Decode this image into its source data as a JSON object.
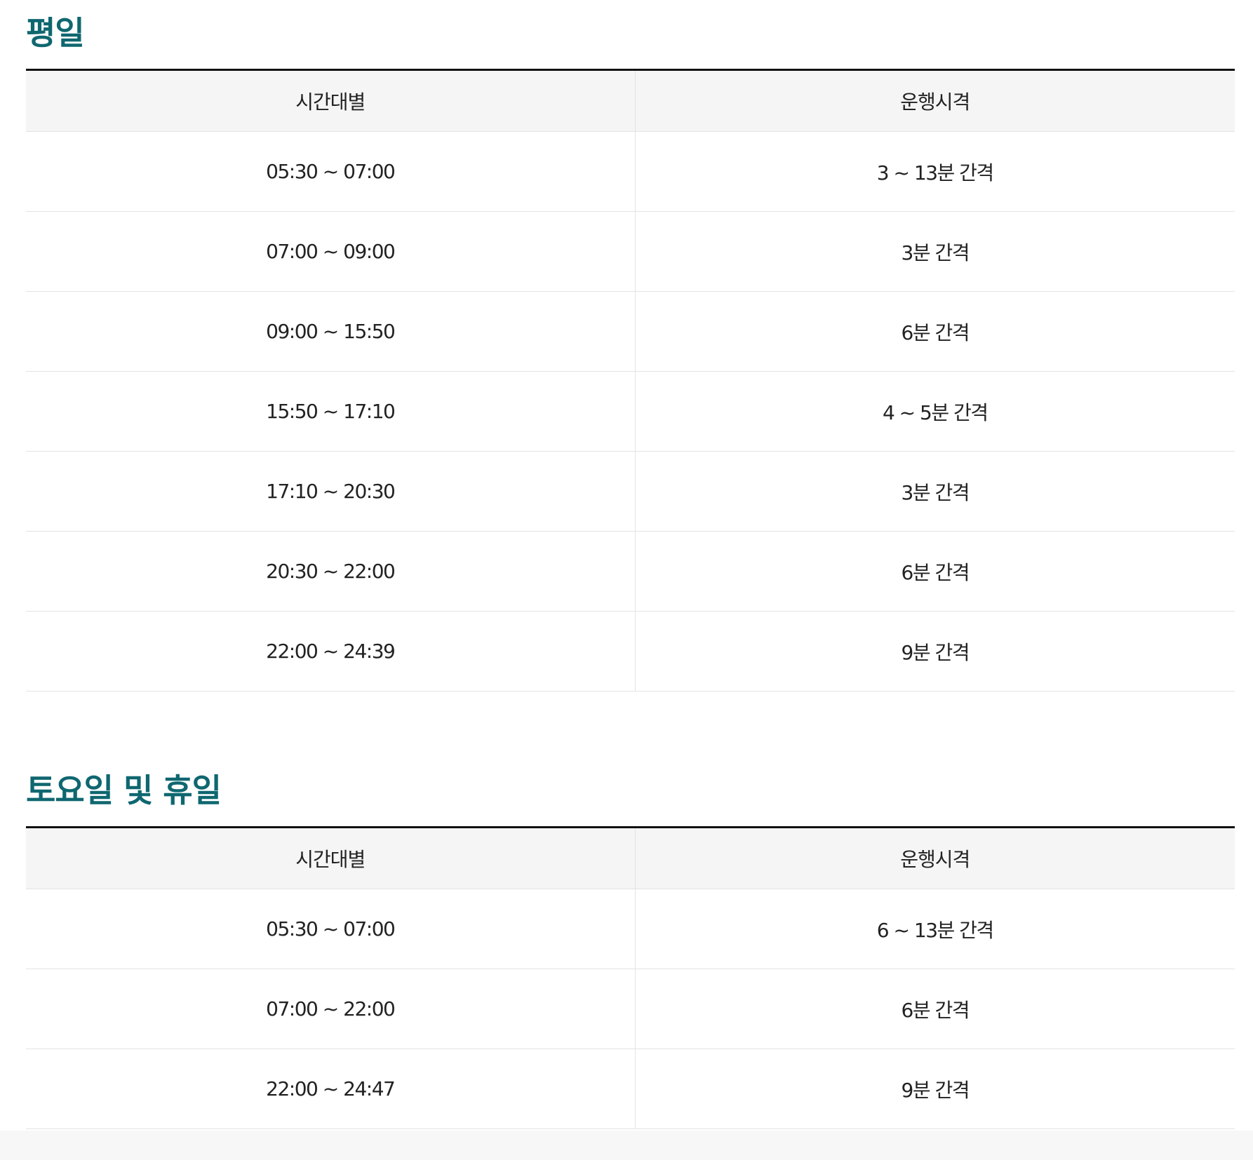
{
  "weekday": {
    "title": "평일",
    "headers": {
      "time": "시간대별",
      "interval": "운행시격"
    },
    "rows": [
      {
        "time": "05:30 ~ 07:00",
        "interval": "3 ~ 13분 간격"
      },
      {
        "time": "07:00 ~ 09:00",
        "interval": "3분 간격"
      },
      {
        "time": "09:00 ~ 15:50",
        "interval": "6분 간격"
      },
      {
        "time": "15:50 ~ 17:10",
        "interval": "4 ~ 5분 간격"
      },
      {
        "time": "17:10 ~ 20:30",
        "interval": "3분 간격"
      },
      {
        "time": "20:30 ~ 22:00",
        "interval": "6분 간격"
      },
      {
        "time": "22:00 ~ 24:39",
        "interval": "9분 간격"
      }
    ]
  },
  "weekend": {
    "title": "토요일 및 휴일",
    "headers": {
      "time": "시간대별",
      "interval": "운행시격"
    },
    "rows": [
      {
        "time": "05:30 ~ 07:00",
        "interval": "6 ~ 13분 간격"
      },
      {
        "time": "07:00 ~ 22:00",
        "interval": "6분 간격"
      },
      {
        "time": "22:00 ~ 24:47",
        "interval": "9분 간격"
      }
    ]
  },
  "colors": {
    "title": "#0f6770",
    "header_bg": "#f5f5f5",
    "top_border": "#111111",
    "grid_line": "#e3e3e3"
  }
}
